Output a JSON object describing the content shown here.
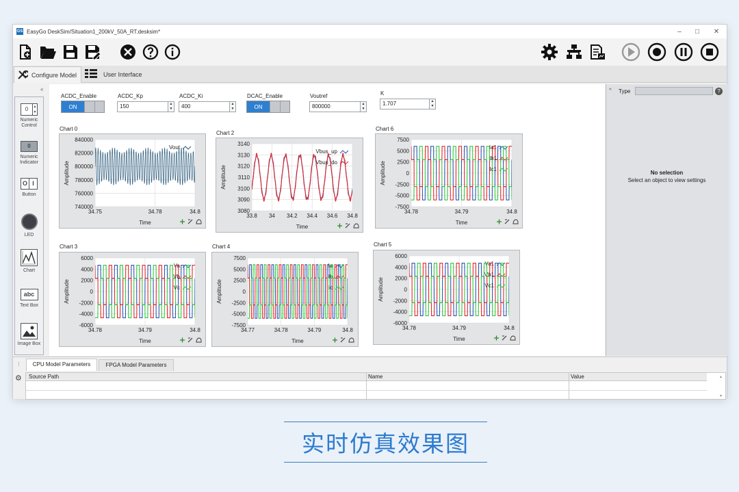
{
  "window": {
    "title": "EasyGo DeskSim/Situation1_200kV_50A_RT.desksim*",
    "app_icon": "GS"
  },
  "toolbar": {
    "left_icons": [
      "new-file-icon",
      "open-folder-icon",
      "save-icon",
      "save-as-icon",
      "tools-icon",
      "help-icon",
      "info-icon"
    ],
    "right_icons": [
      "gear-icon",
      "network-icon",
      "report-icon",
      "run-icon",
      "record-icon",
      "pause-icon",
      "stop-icon"
    ]
  },
  "tabs": {
    "configure": "Configure Model",
    "ui": "User Interface"
  },
  "palette": {
    "numeric_control": "Numeric Control",
    "numeric_indicator": "Numeric Indicator",
    "button": "Button",
    "led": "LED",
    "chart": "Chart",
    "text_box": "Text Box",
    "text_box_glyph": "abc",
    "image_box": "Image Box",
    "control_value": "0",
    "indicator_value": "0",
    "button_glyphs": [
      "O",
      "I"
    ]
  },
  "controls": {
    "acdc_enable": {
      "label": "ACDC_Enable",
      "state": "ON"
    },
    "acdc_kp": {
      "label": "ACDC_Kp",
      "value": "150"
    },
    "acdc_ki": {
      "label": "ACDC_Ki",
      "value": "400"
    },
    "dcac_enable": {
      "label": "DCAC_Enable",
      "state": "ON"
    },
    "voutref": {
      "label": "Voutref",
      "value": "800000"
    },
    "k": {
      "label": "K",
      "value": "1.707"
    }
  },
  "properties": {
    "type_label": "Type",
    "no_selection": "No selection",
    "hint": "Select an object to view settings",
    "help_glyph": "?"
  },
  "bottom": {
    "tabs": [
      "CPU Model Parameters",
      "FPGA Model Parameters"
    ],
    "columns": [
      "Source Path",
      "Name",
      "Value"
    ]
  },
  "caption": "实时仿真效果图",
  "colors": {
    "accent": "#2f7fd0",
    "red": "#e0262b",
    "green": "#2fc73c",
    "blue": "#2b56b0"
  },
  "chart_data": [
    {
      "name": "Chart 0",
      "type": "line",
      "xlabel": "Time",
      "ylabel": "Amplitude",
      "xticks": [
        "34.75",
        "34.78",
        "34.8"
      ],
      "yticks": [
        "840000",
        "820000",
        "800000",
        "780000",
        "760000",
        "740000"
      ],
      "xlim": [
        34.75,
        34.8
      ],
      "ylim": [
        740000,
        840000
      ],
      "series": [
        {
          "name": "Vout",
          "kind": "dense",
          "center": 800000,
          "amp": 28000,
          "color": "#2a5a7a"
        }
      ]
    },
    {
      "name": "Chart 2",
      "type": "line",
      "xlabel": "Time",
      "ylabel": "Amplitude",
      "xticks": [
        "33.8",
        "34",
        "34.2",
        "34.4",
        "34.6",
        "34.8"
      ],
      "yticks": [
        "3140",
        "3130",
        "3120",
        "3110",
        "3100",
        "3090",
        "3080"
      ],
      "xlim": [
        33.8,
        34.8
      ],
      "ylim": [
        3080,
        3140
      ],
      "series": [
        {
          "name": "Vbus_up",
          "kind": "sine",
          "center": 3110,
          "amp": 19,
          "cycles": 7,
          "color": "#2b56b0"
        },
        {
          "name": "Vbus_do",
          "kind": "sine",
          "center": 3110,
          "amp": 20,
          "cycles": 7,
          "color": "#e0262b"
        }
      ]
    },
    {
      "name": "Chart 6",
      "type": "line",
      "xlabel": "Time",
      "ylabel": "Amplitude",
      "xticks": [
        "34.78",
        "34.79",
        "34.8"
      ],
      "yticks": [
        "7500",
        "5000",
        "2500",
        "0",
        "-2500",
        "-5000",
        "-7500"
      ],
      "xlim": [
        34.78,
        34.8
      ],
      "ylim": [
        -7500,
        7500
      ],
      "series": [
        {
          "name": "Ia1",
          "kind": "square3",
          "amp": 6000,
          "phase": 0,
          "cycles": 6,
          "color": "#2b56b0"
        },
        {
          "name": "Ib1",
          "kind": "square3",
          "amp": 6000,
          "phase": 0.333,
          "cycles": 6,
          "color": "#e0262b"
        },
        {
          "name": "Ic1",
          "kind": "square3",
          "amp": 6000,
          "phase": 0.667,
          "cycles": 6,
          "color": "#2fc73c"
        }
      ]
    },
    {
      "name": "Chart 3",
      "type": "line",
      "xlabel": "Time",
      "ylabel": "Amplitude",
      "xticks": [
        "34.78",
        "34.79",
        "34.8"
      ],
      "yticks": [
        "6000",
        "4000",
        "2000",
        "0",
        "-2000",
        "-4000",
        "-6000"
      ],
      "xlim": [
        34.78,
        34.8
      ],
      "ylim": [
        -6000,
        6000
      ],
      "series": [
        {
          "name": "Va",
          "kind": "square3",
          "amp": 4700,
          "phase": 0,
          "cycles": 6,
          "color": "#2b56b0"
        },
        {
          "name": "Vb",
          "kind": "square3",
          "amp": 4700,
          "phase": 0.333,
          "cycles": 6,
          "color": "#e0262b"
        },
        {
          "name": "Vc",
          "kind": "square3",
          "amp": 4700,
          "phase": 0.667,
          "cycles": 6,
          "color": "#2fc73c"
        }
      ]
    },
    {
      "name": "Chart 4",
      "type": "line",
      "xlabel": "Time",
      "ylabel": "Amplitude",
      "xticks": [
        "34.77",
        "34.78",
        "34.79",
        "34.8"
      ],
      "yticks": [
        "7500",
        "5000",
        "2500",
        "0",
        "-2500",
        "-5000",
        "-7500"
      ],
      "xlim": [
        34.77,
        34.8
      ],
      "ylim": [
        -7500,
        7500
      ],
      "series": [
        {
          "name": "Ia",
          "kind": "square3",
          "amp": 6000,
          "phase": 0,
          "cycles": 9,
          "color": "#2b56b0"
        },
        {
          "name": "Ib",
          "kind": "square3",
          "amp": 6000,
          "phase": 0.333,
          "cycles": 9,
          "color": "#e0262b"
        },
        {
          "name": "Ic",
          "kind": "square3",
          "amp": 6000,
          "phase": 0.667,
          "cycles": 9,
          "color": "#2fc73c"
        }
      ]
    },
    {
      "name": "Chart 5",
      "type": "line",
      "xlabel": "Time",
      "ylabel": "Amplitude",
      "xticks": [
        "34.78",
        "34.79",
        "34.8"
      ],
      "yticks": [
        "6000",
        "4000",
        "2000",
        "0",
        "-2000",
        "-4000",
        "-6000"
      ],
      "xlim": [
        34.78,
        34.8
      ],
      "ylim": [
        -6000,
        6000
      ],
      "series": [
        {
          "name": "Va1",
          "kind": "square3",
          "amp": 4700,
          "phase": 0,
          "cycles": 6,
          "color": "#2b56b0"
        },
        {
          "name": "Vb1",
          "kind": "square3",
          "amp": 4700,
          "phase": 0.333,
          "cycles": 6,
          "color": "#e0262b"
        },
        {
          "name": "Vc1",
          "kind": "square3",
          "amp": 4700,
          "phase": 0.667,
          "cycles": 6,
          "color": "#2fc73c"
        }
      ]
    }
  ]
}
